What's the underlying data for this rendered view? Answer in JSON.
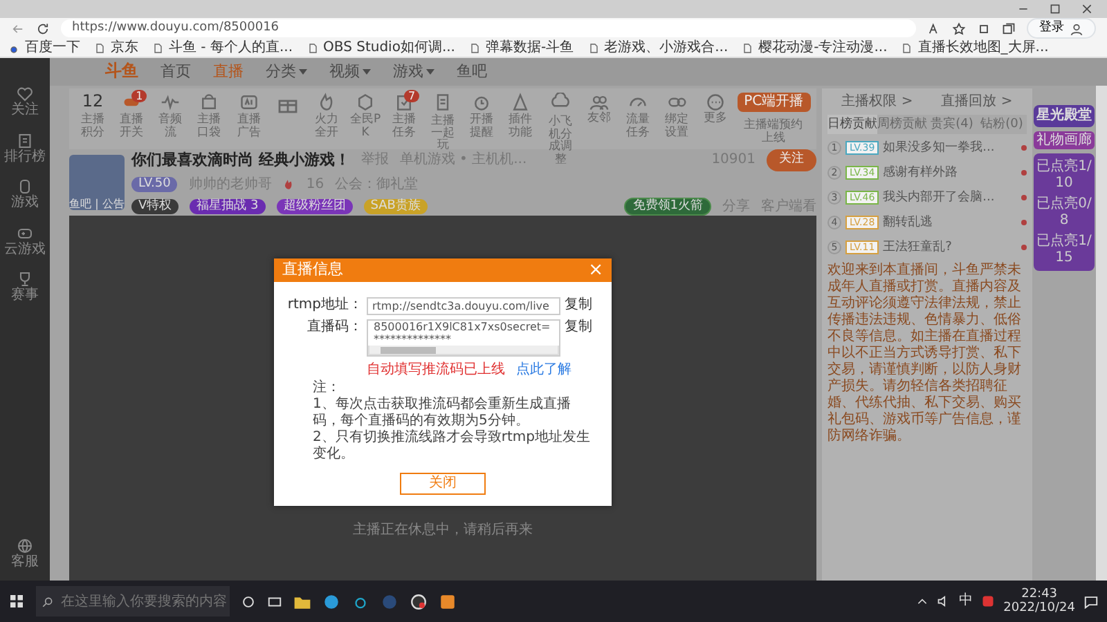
{
  "address_bar": {
    "url": "https://www.douyu.com/8500016"
  },
  "browser_login": "登录",
  "bookmarks": [
    "百度一下",
    "京东",
    "斗鱼 - 每个人的直...",
    "OBS Studio如何调...",
    "弹幕数据-斗鱼",
    "老游戏、小游戏合...",
    "樱花动漫-专注动漫...",
    "直播长效地图_大屏..."
  ],
  "site_nav": {
    "logo": "斗鱼",
    "items": [
      {
        "label": "首页",
        "selected": false,
        "has_menu": false
      },
      {
        "label": "直播",
        "selected": true,
        "has_menu": false
      },
      {
        "label": "分类",
        "selected": false,
        "has_menu": true
      },
      {
        "label": "视频",
        "selected": false,
        "has_menu": true
      },
      {
        "label": "游戏",
        "selected": false,
        "has_menu": true
      },
      {
        "label": "鱼吧",
        "selected": false,
        "has_menu": false
      }
    ]
  },
  "left_sidebar": {
    "items": [
      "关注",
      "排行榜",
      "游戏",
      "云游戏",
      "赛事"
    ],
    "bottom": "客服"
  },
  "anchor_tools": {
    "score": {
      "value": "12",
      "label": "主播积分"
    },
    "items": [
      {
        "label": "直播开关",
        "badge": "1"
      },
      {
        "label": "音频流"
      },
      {
        "label": "主播口袋"
      },
      {
        "label": "直播广告"
      },
      {
        "kind": "icon"
      },
      {
        "label": "火力全开"
      },
      {
        "label": "全民PK"
      },
      {
        "label": "主播任务",
        "badge": "7"
      },
      {
        "label": "主播一起玩"
      },
      {
        "label": "开播提醒"
      },
      {
        "label": "插件功能"
      },
      {
        "label": "小飞机分成调整"
      },
      {
        "label": "友邻"
      },
      {
        "label": "流量任务"
      },
      {
        "label": "绑定设置"
      },
      {
        "label": "更多"
      }
    ],
    "start_button": "PC端开播",
    "start_note": "主播端预约上线"
  },
  "room": {
    "thumb_caption": "鱼吧 | 公告",
    "title": "你们最喜欢滴时尚 经典小游戏！",
    "report": "举报",
    "category": "单机游戏 • 主机机...",
    "level": "LV.50",
    "anchor": "帅帅的老帅哥",
    "hot": "16",
    "guild": "公会：御礼堂",
    "badges": [
      {
        "label": "V特权",
        "color": "#3a3a3a"
      },
      {
        "label": "福星抽战 3",
        "color": "#6a2cb0"
      },
      {
        "label": "超级粉丝团",
        "color": "#7a35b8"
      },
      {
        "label": "SAB贵族",
        "color": "#c9a227"
      }
    ],
    "followers": "10901",
    "follow": "关注",
    "rocket": "免费领1火箭",
    "share": "分享",
    "client": "客户端看"
  },
  "video": {
    "status": "主播正在休息中，请稍后再来"
  },
  "dialog": {
    "title": "直播信息",
    "close": "×",
    "rtmp_label": "rtmp地址：",
    "rtmp_value": "rtmp://sendtc3a.douyu.com/live",
    "code_label": "直播码：",
    "code_value": "8500016r1X9lC81x7xs0secret=**************",
    "copy": [
      "复制",
      "复制"
    ],
    "warning": "自动填写推流码已上线",
    "learn": "点此了解",
    "note_title": "注：",
    "notes": [
      "1、每次点击获取推流码都会重新生成直播码，每个直播码的有效期为5分钟。",
      "2、只有切换推流线路才会导致rtmp地址发生变化。"
    ],
    "button": "关闭"
  },
  "right_panel": {
    "links": [
      "主播权限 >",
      "直播回放 >"
    ],
    "tabs": [
      {
        "label": "日榜贡献",
        "selected": true
      },
      {
        "label": "周榜贡献",
        "selected": false
      },
      {
        "label": "贵宾(4)",
        "selected": false
      },
      {
        "label": "钻粉(0)",
        "selected": false
      }
    ],
    "ranks": [
      {
        "rank": "1",
        "level": "LV.39",
        "color": "#4aa8c0",
        "name": "如果没多知一拳我..."
      },
      {
        "rank": "2",
        "level": "LV.34",
        "color": "#7ab648",
        "name": "感谢有样外路"
      },
      {
        "rank": "3",
        "level": "LV.46",
        "color": "#7ab648",
        "name": "我头内部开了会脑..."
      },
      {
        "rank": "4",
        "level": "LV.28",
        "color": "#d6a040",
        "name": "翻转乱逃"
      },
      {
        "rank": "5",
        "level": "LV.11",
        "color": "#d6a040",
        "name": "王法狂童乱?"
      }
    ],
    "notice": "欢迎来到本直播间，斗鱼严禁未成年人直播或打赏。直播内容及互动评论须遵守法律法规，禁止传播违法违规、色情暴力、低俗不良等信息。如主播在直播过程中以不正当方式诱导打赏、私下交易，请谨慎判断，以防人身财产损失。请勿轻信各类招聘征婚、代练代抽、私下交易、购买礼包码、游戏币等广告信息，谨防网络诈骗。"
  },
  "promo": {
    "title": "星光殿堂",
    "tab": "礼物画廊",
    "items": [
      "已点亮1/10",
      "已点亮0/8",
      "已点亮1/15"
    ]
  },
  "taskbar": {
    "search_placeholder": "在这里输入你要搜索的内容",
    "ime": "中",
    "time": "22:43",
    "date": "2022/10/24"
  }
}
